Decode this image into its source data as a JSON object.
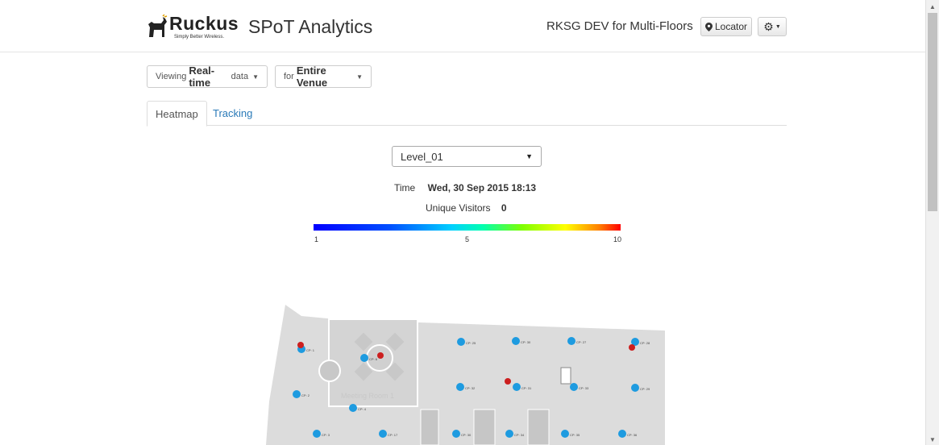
{
  "header": {
    "brand": "Ruckus",
    "brand_tagline": "Simply Better Wireless.",
    "app_title": "SPoT Analytics",
    "venue_name": "RKSG DEV for Multi-Floors",
    "locator_label": "Locator"
  },
  "filters": {
    "viewing_prefix": "Viewing",
    "viewing_value": "Real-time",
    "viewing_suffix": "data",
    "venue_prefix": "for",
    "venue_value": "Entire Venue"
  },
  "tabs": [
    {
      "label": "Heatmap",
      "active": true
    },
    {
      "label": "Tracking",
      "active": false
    }
  ],
  "level_select": {
    "selected": "Level_01"
  },
  "time": {
    "label": "Time",
    "value": "Wed, 30 Sep 2015 18:13"
  },
  "visitors": {
    "label": "Unique Visitors",
    "value": "0"
  },
  "scale": {
    "min": "1",
    "mid": "5",
    "max": "10"
  },
  "colors": {
    "ap_dot": "#1e9be0",
    "visitor_dot": "#cc1f1f",
    "floor": "#dcdcdc",
    "link": "#2a7ab8"
  },
  "access_points": [
    {
      "label": "CP: 1"
    },
    {
      "label": "CP: 6"
    },
    {
      "label": "CP: 25"
    },
    {
      "label": "CP: 30"
    },
    {
      "label": "CP: 27"
    },
    {
      "label": "CP: 28"
    },
    {
      "label": "CP: 2"
    },
    {
      "label": "CP: 32"
    },
    {
      "label": "CP: 31"
    },
    {
      "label": "CP: 33"
    },
    {
      "label": "CP: 29"
    },
    {
      "label": "CP: 4"
    },
    {
      "label": "CP: 3"
    },
    {
      "label": "CP: 17"
    },
    {
      "label": "CP: 30"
    },
    {
      "label": "CP: 34"
    },
    {
      "label": "CP: 35"
    },
    {
      "label": "CP: 36"
    }
  ],
  "floor_labels": {
    "meeting_room": "Meeting Room 1"
  }
}
